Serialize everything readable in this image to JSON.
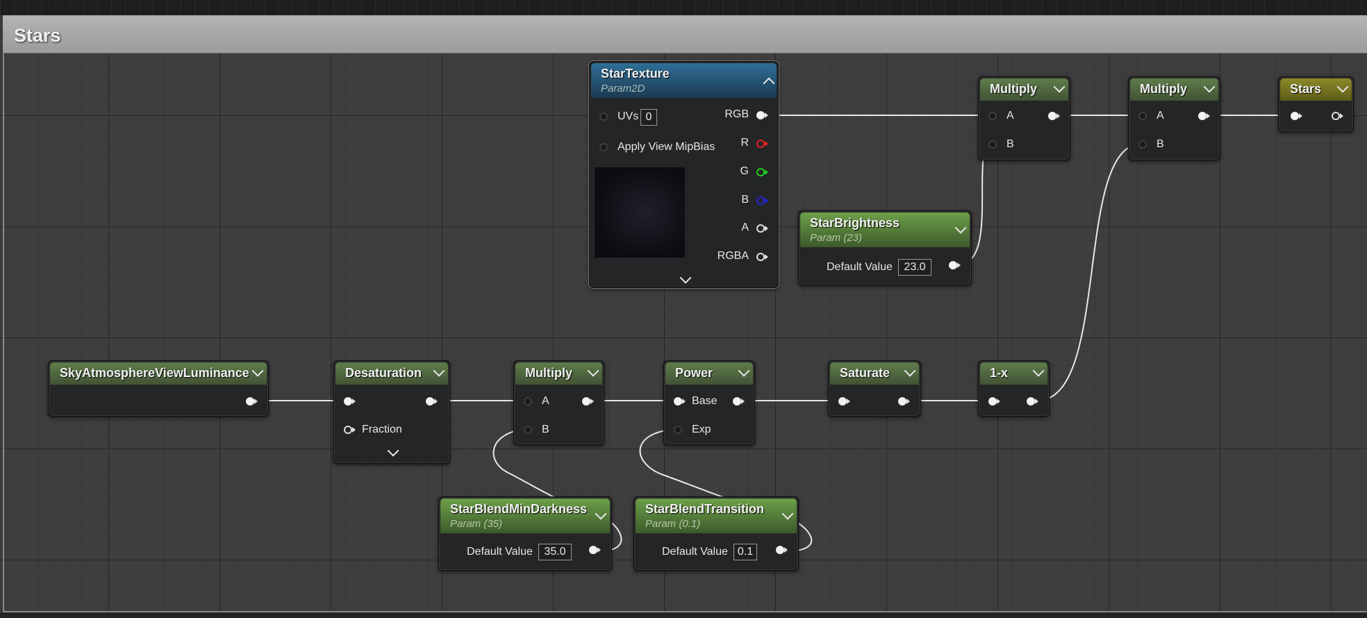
{
  "comment": {
    "title": "Stars"
  },
  "colors": {
    "param_header": "#5e8f3e",
    "math_header": "#52703f",
    "texture_header": "#24608a",
    "output_header": "#7d7c1f",
    "wire": "#e8e8e8"
  },
  "nodes": {
    "star_texture": {
      "title": "StarTexture",
      "subtitle": "Param2D",
      "inputs": {
        "uvs": "UVs",
        "uvs_value": "0",
        "mip": "Apply View MipBias"
      },
      "outputs": {
        "rgb": "RGB",
        "r": "R",
        "g": "G",
        "b": "B",
        "a": "A",
        "rgba": "RGBA"
      }
    },
    "multiply_top1": {
      "title": "Multiply",
      "a": "A",
      "b": "B"
    },
    "multiply_top2": {
      "title": "Multiply",
      "a": "A",
      "b": "B"
    },
    "stars_out": {
      "title": "Stars"
    },
    "star_brightness": {
      "title": "StarBrightness",
      "subtitle": "Param (23)",
      "default_label": "Default Value",
      "default_value": "23.0"
    },
    "sky_luminance": {
      "title": "SkyAtmosphereViewLuminance"
    },
    "desaturation": {
      "title": "Desaturation",
      "fraction": "Fraction"
    },
    "multiply_mid": {
      "title": "Multiply",
      "a": "A",
      "b": "B"
    },
    "power": {
      "title": "Power",
      "base": "Base",
      "exp": "Exp"
    },
    "saturate": {
      "title": "Saturate"
    },
    "one_minus": {
      "title": "1-x"
    },
    "star_blend_min_darkness": {
      "title": "StarBlendMinDarkness",
      "subtitle": "Param (35)",
      "default_label": "Default Value",
      "default_value": "35.0"
    },
    "star_blend_transition": {
      "title": "StarBlendTransition",
      "subtitle": "Param (0.1)",
      "default_label": "Default Value",
      "default_value": "0.1"
    }
  }
}
